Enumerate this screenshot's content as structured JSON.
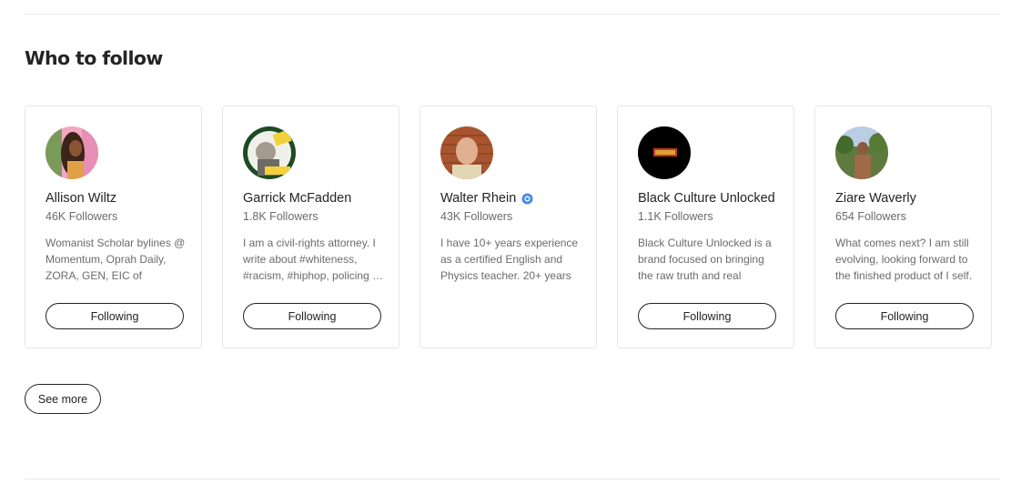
{
  "section": {
    "title": "Who to follow"
  },
  "cards": [
    {
      "name": "Allison Wiltz",
      "followers": "46K Followers",
      "bio": "Womanist Scholar bylines @ Momentum, Oprah Daily, ZORA, GEN, EIC of Cultured…",
      "button": "Following",
      "verified": false,
      "avatar_icon": "illustrated-woman-avatar"
    },
    {
      "name": "Garrick McFadden",
      "followers": "1.8K Followers",
      "bio": "I am a civil-rights attorney. I write about #whiteness, #racism, #hiphop, policing …",
      "button": "Following",
      "verified": false,
      "avatar_icon": "man-with-medium-badge-avatar"
    },
    {
      "name": "Walter Rhein",
      "followers": "43K Followers",
      "bio": "I have 10+ years experience as a certified English and Physics teacher. 20+ years …",
      "button": "",
      "verified": true,
      "avatar_icon": "man-brick-wall-avatar"
    },
    {
      "name": "Black Culture Unlocked",
      "followers": "1.1K Followers",
      "bio": "Black Culture Unlocked is a brand focused on bringing the raw truth and real histor…",
      "button": "Following",
      "verified": false,
      "avatar_icon": "black-logo-avatar"
    },
    {
      "name": "Ziare Waverly",
      "followers": "654 Followers",
      "bio": "What comes next? I am still evolving, looking forward to the finished product of I self.",
      "button": "Following",
      "verified": false,
      "avatar_icon": "person-outdoors-avatar"
    }
  ],
  "see_more_label": "See more",
  "colors": {
    "text": "#242424",
    "muted": "#6b6b6b",
    "border": "#e6e6e6",
    "verified": "#4a8cea"
  }
}
